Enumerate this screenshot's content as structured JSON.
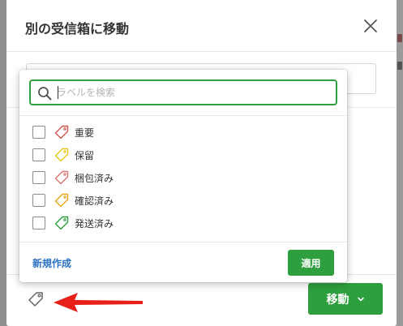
{
  "dialog": {
    "title": "別の受信箱に移動",
    "close_icon": "close-icon"
  },
  "popover": {
    "search": {
      "placeholder": "ラベルを検索",
      "value": "",
      "icon": "search-icon"
    },
    "labels": [
      {
        "label": "重要",
        "checked": false,
        "color": "#d9534f"
      },
      {
        "label": "保留",
        "checked": false,
        "color": "#e6c619"
      },
      {
        "label": "梱包済み",
        "checked": false,
        "color": "#d9736f"
      },
      {
        "label": "確認済み",
        "checked": false,
        "color": "#e8a317"
      },
      {
        "label": "発送済み",
        "checked": false,
        "color": "#2e9f3e"
      }
    ],
    "new_label": "新規作成",
    "apply_label": "適用"
  },
  "footer": {
    "tag_icon": "tag-icon",
    "move_label": "移動",
    "move_icon": "chevron-down-icon"
  },
  "annotation": {
    "arrow_color": "#e8201a"
  },
  "colors": {
    "accent": "#2e9f3e",
    "link": "#2b72c2"
  }
}
